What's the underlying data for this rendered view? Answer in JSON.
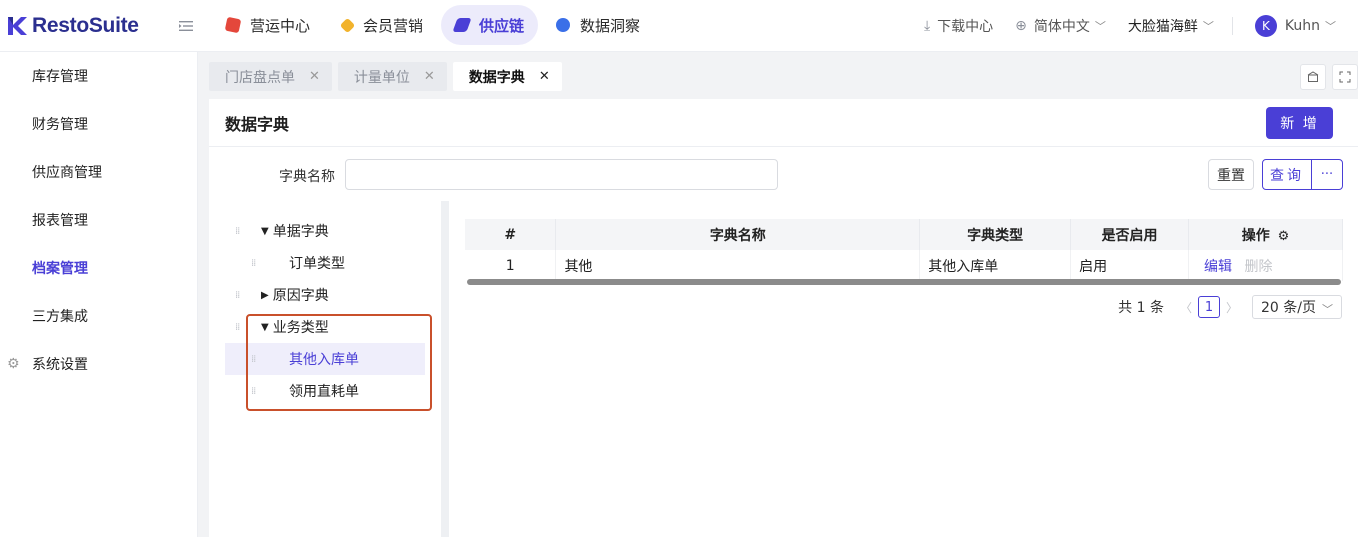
{
  "app": {
    "name": "RestoSuite"
  },
  "nav": {
    "items": [
      {
        "label": "营运中心",
        "color": "#e4473b",
        "active": false
      },
      {
        "label": "会员营销",
        "color": "#f2b32c",
        "active": false
      },
      {
        "label": "供应链",
        "color": "#4a3fd6",
        "active": true
      },
      {
        "label": "数据洞察",
        "color": "#3a6fe8",
        "active": false
      }
    ],
    "download": "下载中心",
    "language": "简体中文",
    "store": "大脸猫海鲜",
    "user_initial": "K",
    "user_name": "Kuhn"
  },
  "sidebar": {
    "items": [
      {
        "label": "库存管理"
      },
      {
        "label": "财务管理"
      },
      {
        "label": "供应商管理"
      },
      {
        "label": "报表管理"
      },
      {
        "label": "档案管理"
      },
      {
        "label": "三方集成"
      },
      {
        "label": "系统设置"
      }
    ]
  },
  "tabs": [
    {
      "label": "门店盘点单"
    },
    {
      "label": "计量单位"
    },
    {
      "label": "数据字典"
    }
  ],
  "page": {
    "title": "数据字典",
    "add_button": "新 增",
    "search_label": "字典名称",
    "search_value": "",
    "reset_button": "重置",
    "query_button": "查询",
    "more_button": "···"
  },
  "tree": {
    "nodes": [
      {
        "label": "单据字典",
        "level": 0,
        "expanded": true
      },
      {
        "label": "订单类型",
        "level": 1
      },
      {
        "label": "原因字典",
        "level": 0,
        "expanded": false
      },
      {
        "label": "业务类型",
        "level": 0,
        "expanded": true
      },
      {
        "label": "其他入库单",
        "level": 1,
        "selected": true
      },
      {
        "label": "领用直耗单",
        "level": 1
      }
    ]
  },
  "table": {
    "headers": [
      "#",
      "字典名称",
      "字典类型",
      "是否启用",
      "操作"
    ],
    "rows": [
      {
        "index": "1",
        "name": "其他",
        "type": "其他入库单",
        "enabled": "启用",
        "edit": "编辑",
        "delete": "删除"
      }
    ]
  },
  "pager": {
    "total": "共 1 条",
    "current": "1",
    "page_size": "20 条/页"
  },
  "colors": {
    "accent": "#4a3fd6",
    "highlight_box": "#c9502b"
  }
}
